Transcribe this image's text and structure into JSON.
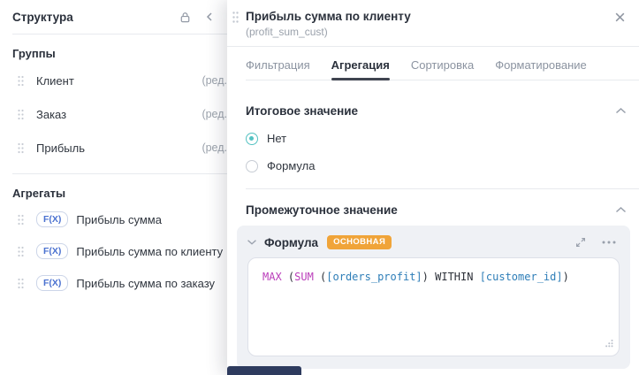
{
  "colors": {
    "accent_teal": "#54c2c2",
    "badge_orange": "#f0a439",
    "fx_badge_text": "#4a71d0",
    "active_tab_underline": "#3f4450",
    "code_function": "#ba3dba",
    "code_field": "#2e7eb8",
    "code_plain": "#2c3038",
    "partial_bar": "#2e3b5e"
  },
  "sidebar": {
    "title": "Структура",
    "icons": [
      "lock-icon",
      "chevron-left-icon"
    ],
    "groups_heading": "Группы",
    "groups": [
      {
        "label": "Клиент",
        "meta": "(ред."
      },
      {
        "label": "Заказ",
        "meta": "(ред."
      },
      {
        "label": "Прибыль",
        "meta": "(ред."
      }
    ],
    "aggregates_heading": "Агрегаты",
    "aggregates": [
      {
        "badge": "F(X)",
        "label": "Прибыль сумма"
      },
      {
        "badge": "F(X)",
        "label": "Прибыль сумма по клиенту"
      },
      {
        "badge": "F(X)",
        "label": "Прибыль сумма по заказу"
      }
    ]
  },
  "panel": {
    "title": "Прибыль сумма по клиенту",
    "subtitle": "(profit_sum_cust)",
    "close_icon": "close-icon",
    "tabs": [
      {
        "label": "Фильтрация",
        "active": false
      },
      {
        "label": "Агрегация",
        "active": true
      },
      {
        "label": "Сортировка",
        "active": false
      },
      {
        "label": "Форматирование",
        "active": false
      }
    ],
    "total_section": {
      "heading": "Итоговое значение",
      "collapse_icon": "chevron-up-icon",
      "options": [
        {
          "label": "Нет",
          "selected": true
        },
        {
          "label": "Формула",
          "selected": false
        }
      ]
    },
    "intermediate_section": {
      "heading": "Промежуточное значение",
      "collapse_icon": "chevron-up-icon",
      "formula_card": {
        "expander_icon": "chevron-down-icon",
        "title": "Формула",
        "badge": "ОСНОВНАЯ",
        "actions": [
          "expand-icon",
          "more-menu-icon"
        ],
        "code": "MAX (SUM ([orders_profit]) WITHIN [customer_id])",
        "code_tokens": [
          {
            "t": "MAX",
            "c": "func"
          },
          {
            "t": " (",
            "c": "plain"
          },
          {
            "t": "SUM",
            "c": "func"
          },
          {
            "t": " (",
            "c": "plain"
          },
          {
            "t": "[orders_profit]",
            "c": "field"
          },
          {
            "t": ")",
            "c": "plain"
          },
          {
            "t": " WITHIN ",
            "c": "plain"
          },
          {
            "t": "[customer_id]",
            "c": "field"
          },
          {
            "t": ")",
            "c": "plain"
          }
        ]
      }
    }
  }
}
